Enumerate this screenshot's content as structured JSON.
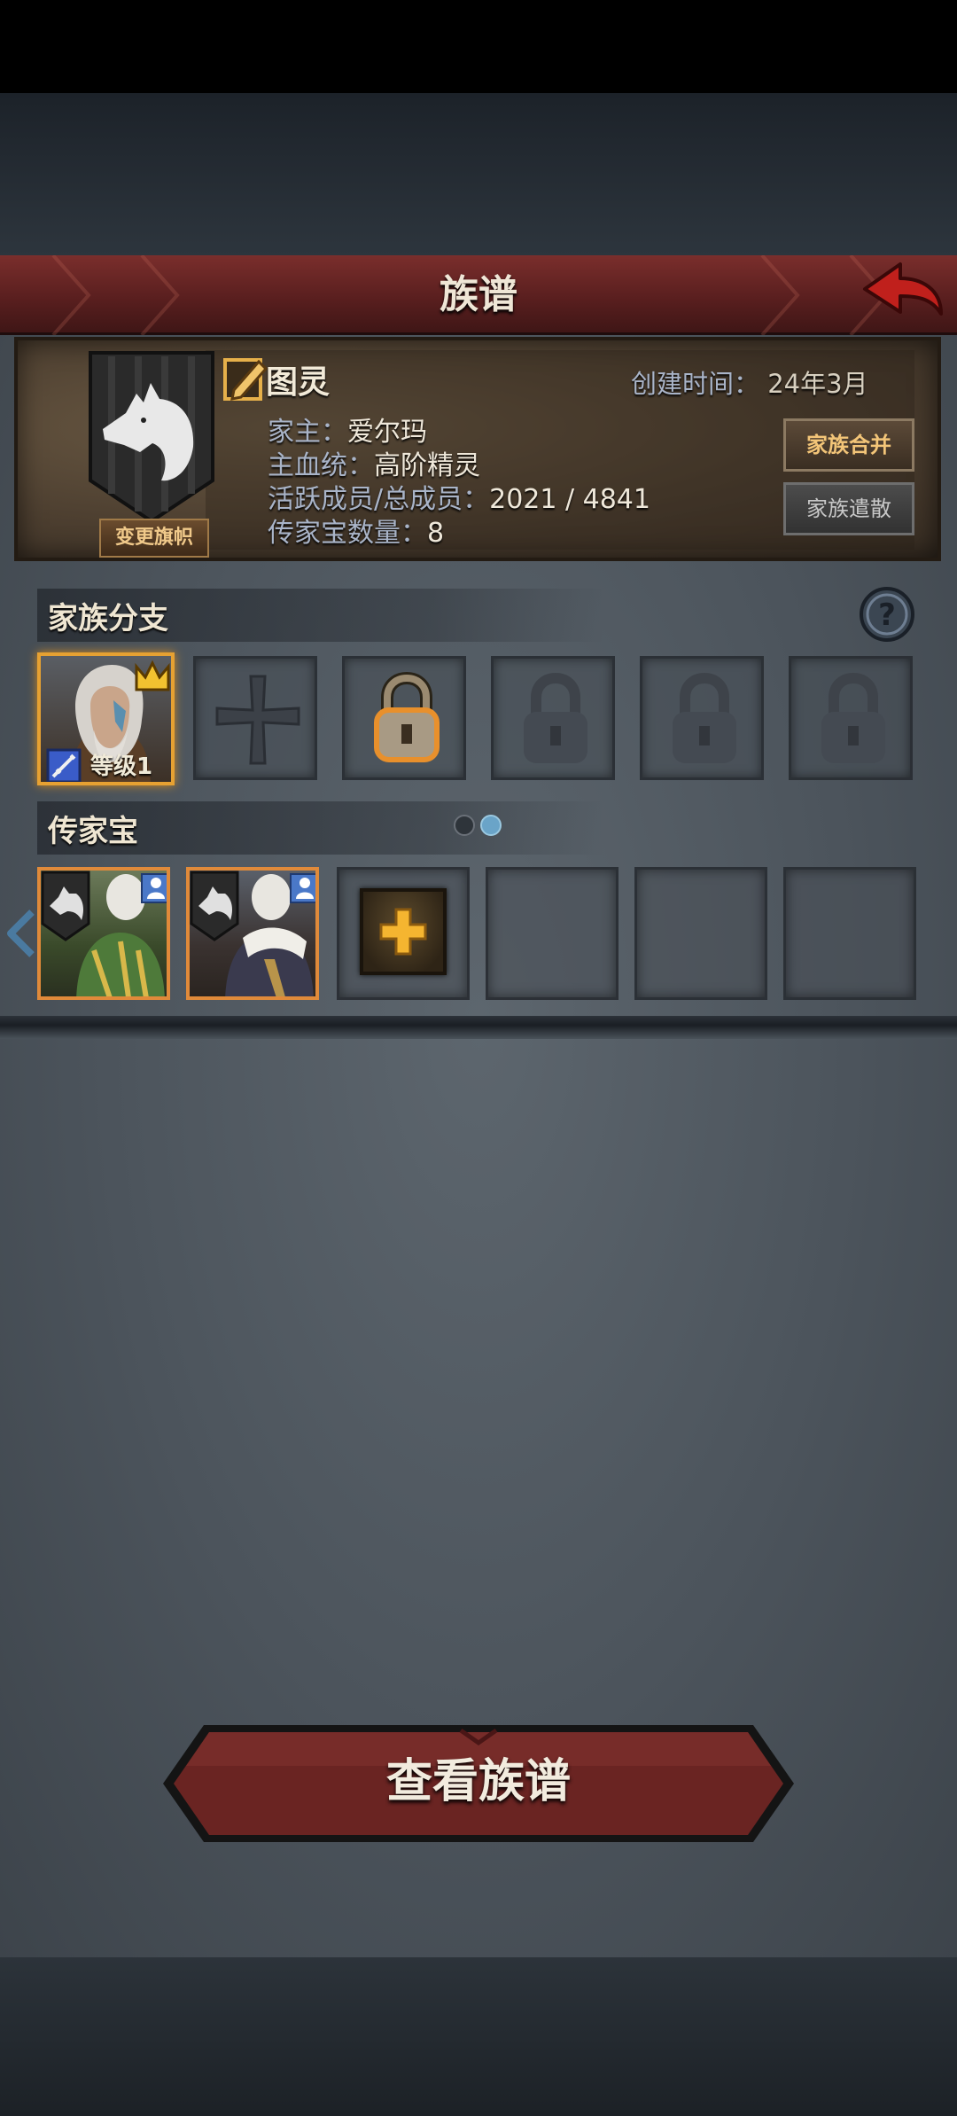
{
  "title": "族谱",
  "header": {
    "change_banner": "变更旗帜",
    "family_name": "图灵",
    "created_label": "创建时间：",
    "created_value": "24年3月",
    "leader_label": "家主：",
    "leader_value": "爱尔玛",
    "bloodline_label": "主血统：",
    "bloodline_value": "高阶精灵",
    "members_label": "活跃成员/总成员：",
    "members_value": "2021 / 4841",
    "heirloom_count_label": "传家宝数量：",
    "heirloom_count_value": "8",
    "merge_button": "家族合并",
    "disband_button": "家族遣散"
  },
  "branches": {
    "title": "家族分支",
    "hero_level": "等级1",
    "slots": [
      "hero",
      "empty-cross",
      "locked-active",
      "locked",
      "locked",
      "locked"
    ]
  },
  "heirlooms": {
    "title": "传家宝",
    "page_indicator": {
      "pages": 2,
      "active": 2
    },
    "slots": [
      "item",
      "item",
      "add",
      "empty",
      "empty",
      "empty"
    ]
  },
  "view_button": "查看族谱",
  "colors": {
    "title_bar": "#6b2826",
    "accent_gold": "#e6a132",
    "label_blue": "#a9b4c8"
  }
}
